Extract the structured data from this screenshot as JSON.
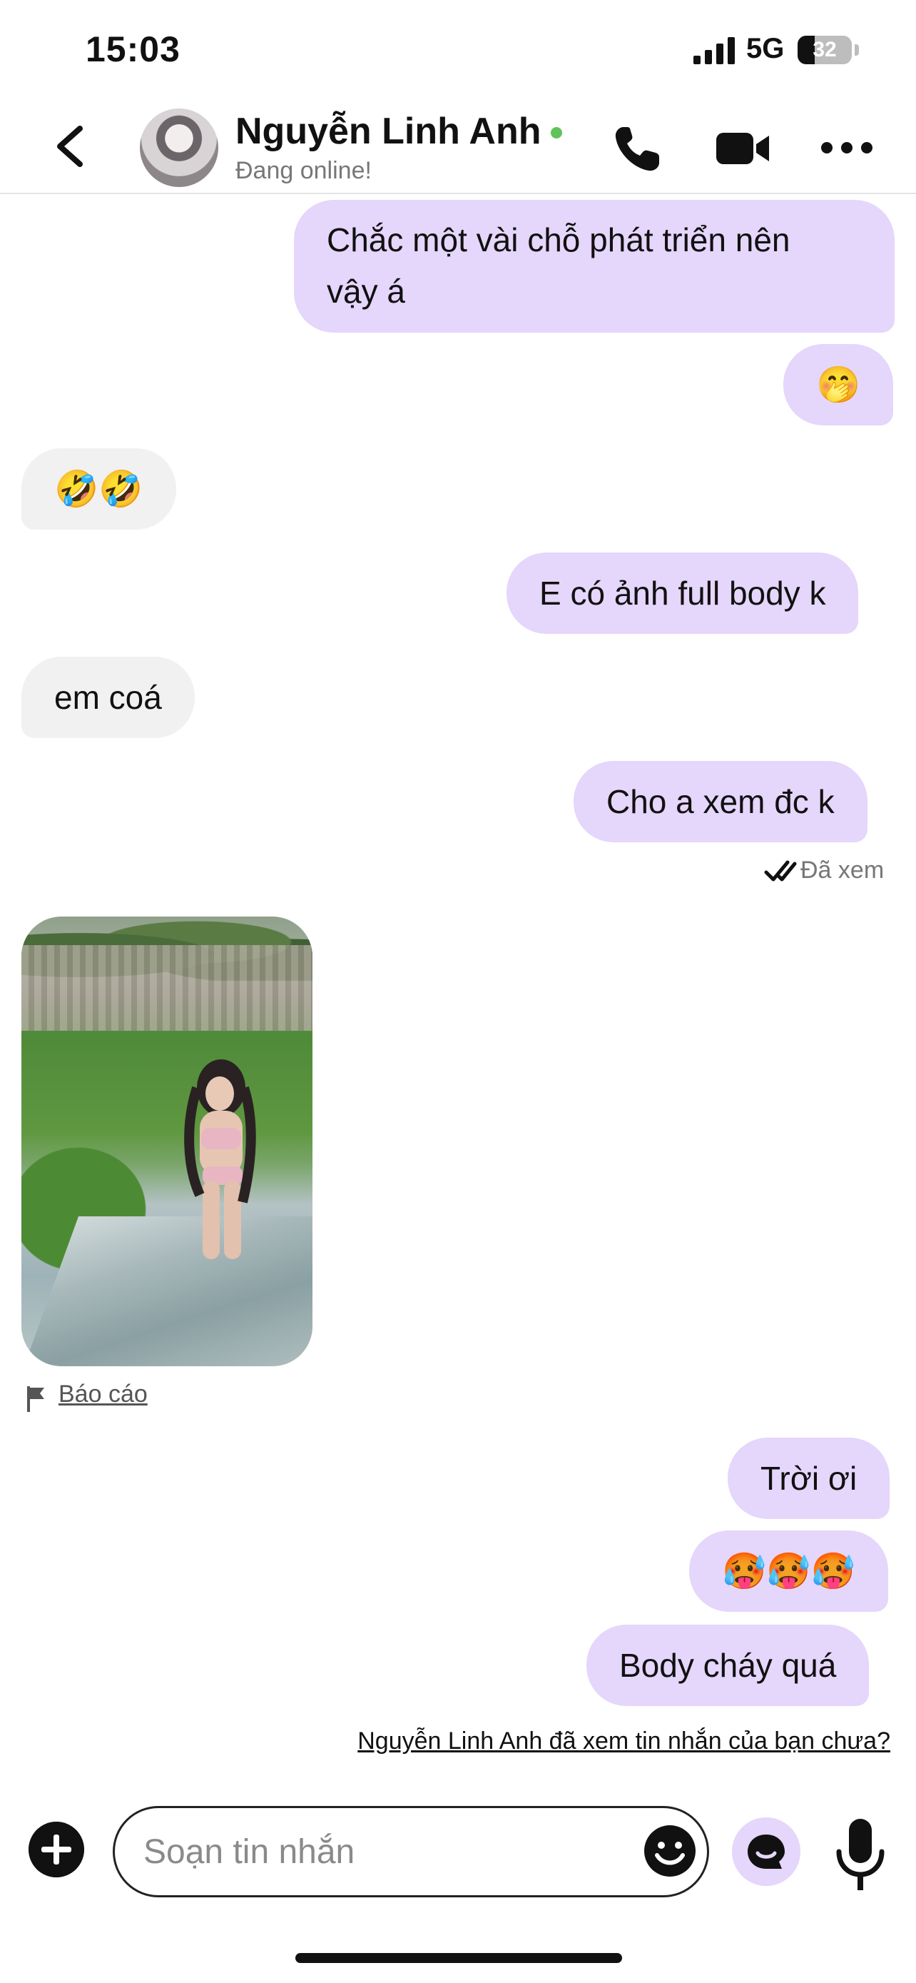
{
  "status_bar": {
    "time": "15:03",
    "network": "5G",
    "battery_percent": "32",
    "battery_level": 0.32
  },
  "header": {
    "contact_name": "Nguyễn Linh Anh",
    "contact_status": "Đang online!",
    "icons": [
      "back-chevron",
      "phone",
      "video-camera",
      "more-dots"
    ]
  },
  "messages": [
    {
      "id": "m1",
      "direction": "outgoing",
      "text": "Chắc một vài chỗ phát triển nên\nvậy á"
    },
    {
      "id": "m2",
      "direction": "outgoing",
      "text": "🤭"
    },
    {
      "id": "m3",
      "direction": "incoming",
      "text": "🤣🤣"
    },
    {
      "id": "m4",
      "direction": "outgoing",
      "text": "E có ảnh full body k"
    },
    {
      "id": "m5",
      "direction": "incoming",
      "text": "em coá"
    },
    {
      "id": "m6",
      "direction": "outgoing",
      "text": "Cho a xem đc k"
    },
    {
      "id": "m7",
      "direction": "incoming",
      "type": "photo"
    },
    {
      "id": "m8",
      "direction": "outgoing",
      "text": "Trời ơi"
    },
    {
      "id": "m9",
      "direction": "outgoing",
      "text": "🥵🥵🥵"
    },
    {
      "id": "m10",
      "direction": "outgoing",
      "text": "Body cháy quá"
    }
  ],
  "seen_label": "Đã xem",
  "report_label": "Báo cáo",
  "receipt_prompt": "Nguyễn Linh Anh đã xem tin nhắn của bạn chưa?",
  "composer": {
    "placeholder": "Soạn tin nhắn"
  },
  "colors": {
    "outgoing_bubble": "#e5d6fb",
    "incoming_bubble": "#f1f1f1",
    "online_dot": "#5fc35a"
  }
}
